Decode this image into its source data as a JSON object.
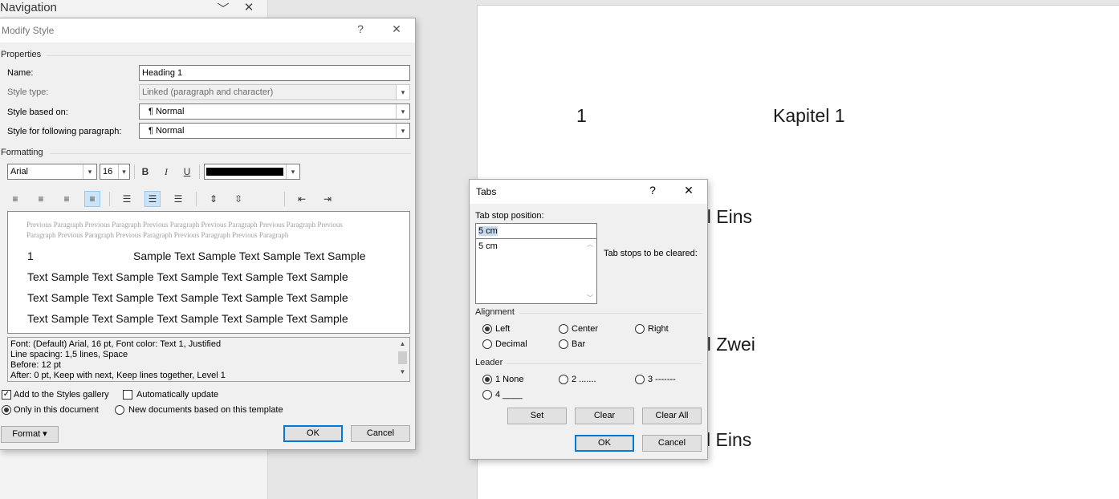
{
  "navigation": {
    "title": "Navigation"
  },
  "document": {
    "lines": [
      {
        "number": "1",
        "text": "Kapitel 1"
      },
      {
        "text": "el Eins"
      },
      {
        "text": "el Zwei"
      },
      {
        "text": "l Eins"
      }
    ]
  },
  "modify_style": {
    "title": "Modify Style",
    "help": "?",
    "properties_label": "Properties",
    "name_label": "Name:",
    "name_value": "Heading 1",
    "style_type_label": "Style type:",
    "style_type_value": "Linked (paragraph and character)",
    "based_on_label": "Style based on:",
    "based_on_value": "¶  Normal",
    "following_label": "Style for following paragraph:",
    "following_value": "¶  Normal",
    "formatting_label": "Formatting",
    "font": "Arial",
    "size": "16",
    "bold": "B",
    "italic": "I",
    "underline": "U",
    "font_color": "#000000",
    "preview": {
      "previous_1": "Previous Paragraph Previous Paragraph Previous Paragraph Previous Paragraph Previous Paragraph Previous",
      "previous_2": "Paragraph Previous Paragraph Previous Paragraph Previous Paragraph Previous Paragraph",
      "number": "1",
      "first_line": "Sample Text Sample Text Sample Text Sample",
      "lines": [
        "Text Sample Text Sample Text Sample Text Sample Text Sample",
        "Text Sample Text Sample Text Sample Text Sample Text Sample",
        "Text Sample Text Sample Text Sample Text Sample Text Sample"
      ]
    },
    "description": [
      "Font: (Default) Arial, 16 pt, Font color: Text 1, Justified",
      "    Line spacing:  1,5 lines, Space",
      "    Before:  12 pt",
      "    After:  0 pt, Keep with next, Keep lines together, Level 1"
    ],
    "add_to_gallery": "Add to the Styles gallery",
    "auto_update": "Automatically update",
    "only_this_doc": "Only in this document",
    "new_docs": "New documents based on this template",
    "format_button": "Format ▾",
    "ok": "OK",
    "cancel": "Cancel"
  },
  "tabs_dialog": {
    "title": "Tabs",
    "help": "?",
    "tab_stop_label": "Tab stop position:",
    "tab_stop_value": "5 cm",
    "tab_list": [
      "5 cm"
    ],
    "to_be_cleared": "Tab stops to be cleared:",
    "alignment_label": "Alignment",
    "alignment": [
      "Left",
      "Center",
      "Right",
      "Decimal",
      "Bar"
    ],
    "leader_label": "Leader",
    "leader": [
      "1 None",
      "2 .......",
      "3 -------",
      "4 ____"
    ],
    "set": "Set",
    "clear": "Clear",
    "clear_all": "Clear All",
    "ok": "OK",
    "cancel": "Cancel"
  }
}
